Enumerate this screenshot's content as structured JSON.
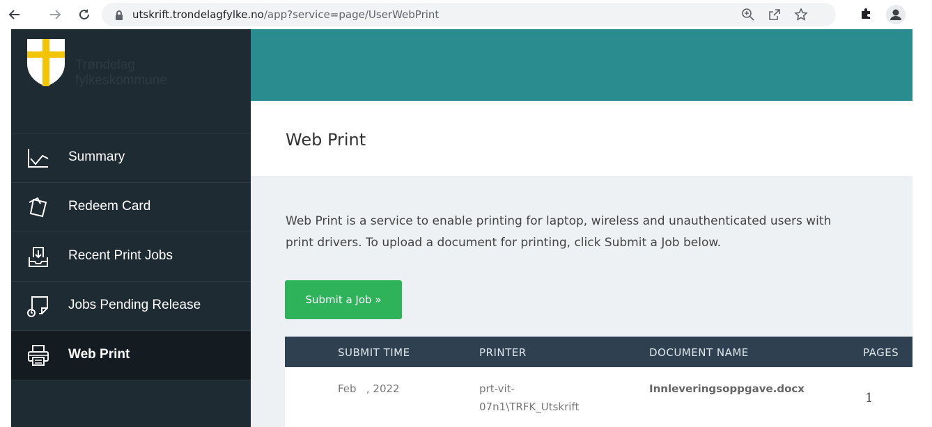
{
  "browser": {
    "url_host": "utskrift.trondelagfylke.no",
    "url_path": "/app?service=page/UserWebPrint",
    "icons": [
      "back-icon",
      "forward-icon",
      "reload-icon",
      "lock-icon",
      "zoom-icon",
      "share-icon",
      "bookmark-star-icon",
      "extensions-puzzle-icon",
      "profile-icon"
    ]
  },
  "sidebar": {
    "logo_text": "Trøndelag fylkeskommune",
    "items": [
      {
        "label": "Summary",
        "icon": "chart-line-icon"
      },
      {
        "label": "Redeem Card",
        "icon": "cards-icon"
      },
      {
        "label": "Recent Print Jobs",
        "icon": "tray-icon"
      },
      {
        "label": "Jobs Pending Release",
        "icon": "pending-release-icon"
      },
      {
        "label": "Web Print",
        "icon": "printer-icon",
        "active": true
      }
    ]
  },
  "main": {
    "title": "Web Print",
    "description_line1": "Web Print is a service to enable printing for laptop, wireless and unauthenticated users with",
    "description_line2": "print drivers. To upload a document for printing, click Submit a Job below.",
    "submit_button": "Submit a Job »",
    "table": {
      "headers": [
        "SUBMIT TIME",
        "PRINTER",
        "DOCUMENT NAME",
        "PAGES"
      ],
      "rows": [
        {
          "submit_time": "Feb   , 2022",
          "printer_line1": "prt-vit-",
          "printer_line2": "07n1\\TRFK_Utskrift",
          "document": "Innleveringsoppgave.docx",
          "pages": "1"
        }
      ]
    }
  },
  "colors": {
    "sidebar_bg": "#1f2b33",
    "topbar_teal": "#2a8c8f",
    "submit_green": "#2fb35a",
    "table_header_bg": "#2f4150",
    "content_bg": "#eef1f3"
  }
}
